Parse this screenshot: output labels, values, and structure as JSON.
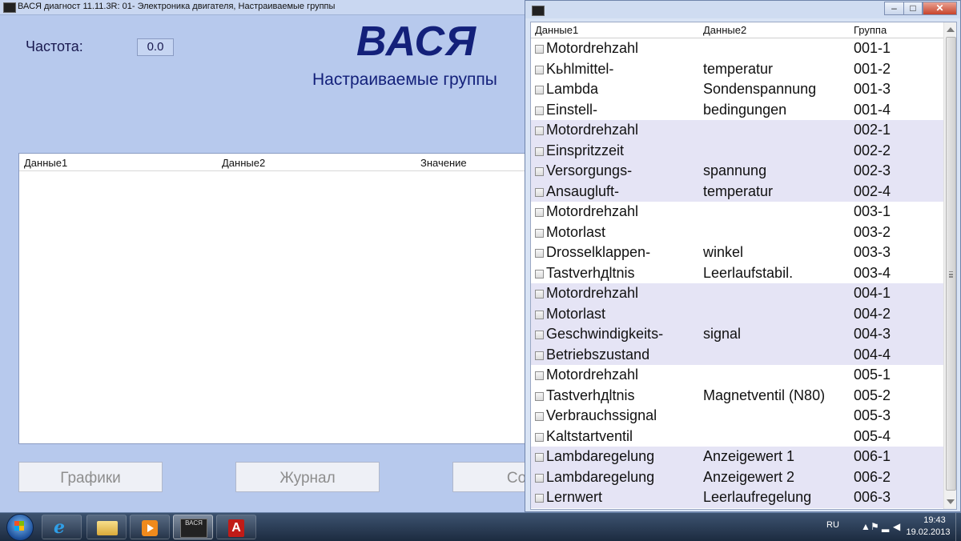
{
  "main_window": {
    "title": "ВАСЯ диагност 11.11.3R: 01- Электроника двигателя,  Настраиваемые группы",
    "frequency_label": "Частота:",
    "frequency_value": "0.0",
    "logo_title": "ВАСЯ",
    "subtitle": "Настраиваемые группы",
    "table": {
      "columns": [
        "Данные1",
        "Данные2",
        "Значение"
      ]
    },
    "buttons": {
      "graphs": "Графики",
      "journal": "Журнал",
      "save": "Сохр"
    }
  },
  "list_window": {
    "columns": [
      "Данные1",
      "Данные2",
      "Группа"
    ],
    "rows": [
      {
        "d1": "Motordrehzahl",
        "d2": "",
        "group": "001-1"
      },
      {
        "d1": "Kьhlmittel-",
        "d2": "temperatur",
        "group": "001-2"
      },
      {
        "d1": "Lambda",
        "d2": "Sondenspannung",
        "group": "001-3"
      },
      {
        "d1": "Einstell-",
        "d2": "bedingungen",
        "group": "001-4"
      },
      {
        "d1": "Motordrehzahl",
        "d2": "",
        "group": "002-1"
      },
      {
        "d1": "Einspritzzeit",
        "d2": "",
        "group": "002-2"
      },
      {
        "d1": "Versorgungs-",
        "d2": "spannung",
        "group": "002-3"
      },
      {
        "d1": "Ansaugluft-",
        "d2": "temperatur",
        "group": "002-4"
      },
      {
        "d1": "Motordrehzahl",
        "d2": "",
        "group": "003-1"
      },
      {
        "d1": "Motorlast",
        "d2": "",
        "group": "003-2"
      },
      {
        "d1": "Drosselklappen-",
        "d2": "winkel",
        "group": "003-3"
      },
      {
        "d1": "Tastverhдltnis",
        "d2": "Leerlaufstabil.",
        "group": "003-4"
      },
      {
        "d1": "Motordrehzahl",
        "d2": "",
        "group": "004-1"
      },
      {
        "d1": "Motorlast",
        "d2": "",
        "group": "004-2"
      },
      {
        "d1": "Geschwindigkeits-",
        "d2": "signal",
        "group": "004-3"
      },
      {
        "d1": "Betriebszustand",
        "d2": "",
        "group": "004-4"
      },
      {
        "d1": "Motordrehzahl",
        "d2": "",
        "group": "005-1"
      },
      {
        "d1": "Tastverhдltnis",
        "d2": "Magnetventil (N80)",
        "group": "005-2"
      },
      {
        "d1": "Verbrauchssignal",
        "d2": "",
        "group": "005-3"
      },
      {
        "d1": "Kaltstartventil",
        "d2": "",
        "group": "005-4"
      },
      {
        "d1": "Lambdaregelung",
        "d2": "Anzeigewert 1",
        "group": "006-1"
      },
      {
        "d1": "Lambdaregelung",
        "d2": "Anzeigewert 2",
        "group": "006-2"
      },
      {
        "d1": "Lernwert",
        "d2": "Leerlaufregelung",
        "group": "006-3"
      }
    ],
    "window_buttons": {
      "minimize": "–",
      "maximize": "□",
      "close": "✕"
    },
    "band_color": "#e5e4f5"
  },
  "taskbar": {
    "vasya_label": "ВАСЯ",
    "pdf_label": "A",
    "ie_label": "e",
    "tray": {
      "language": "RU",
      "time": "19:43",
      "date": "19.02.2013"
    }
  }
}
